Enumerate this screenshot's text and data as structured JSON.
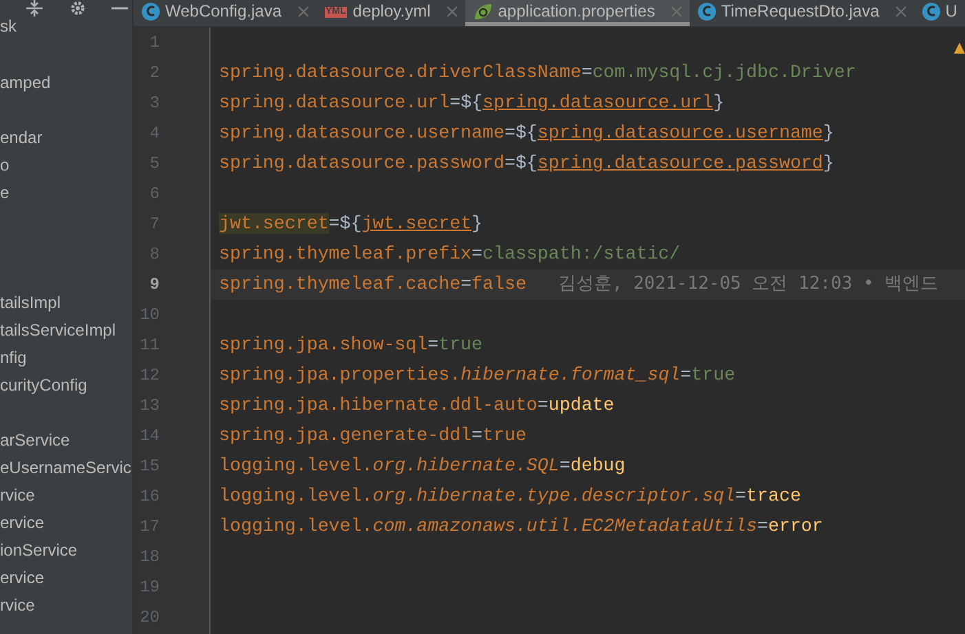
{
  "sidebar": {
    "items": [
      {
        "kind": "item",
        "label": "sk"
      },
      {
        "kind": "blank"
      },
      {
        "kind": "item",
        "label": "amped"
      },
      {
        "kind": "blank"
      },
      {
        "kind": "item",
        "label": "endar"
      },
      {
        "kind": "item",
        "label": "o"
      },
      {
        "kind": "item",
        "label": "e"
      },
      {
        "kind": "blank"
      },
      {
        "kind": "blank"
      },
      {
        "kind": "blank"
      },
      {
        "kind": "item",
        "label": "tailsImpl"
      },
      {
        "kind": "item",
        "label": "tailsServiceImpl"
      },
      {
        "kind": "item",
        "label": "nfig"
      },
      {
        "kind": "item",
        "label": "curityConfig"
      },
      {
        "kind": "blank"
      },
      {
        "kind": "item",
        "label": "arService"
      },
      {
        "kind": "item",
        "label": "eUsernameServic"
      },
      {
        "kind": "item",
        "label": "rvice"
      },
      {
        "kind": "item",
        "label": "ervice"
      },
      {
        "kind": "item",
        "label": "ionService"
      },
      {
        "kind": "item",
        "label": "ervice"
      },
      {
        "kind": "item",
        "label": "rvice"
      }
    ]
  },
  "tabs": [
    {
      "label": "WebConfig.java",
      "kind": "java",
      "selected": false
    },
    {
      "label": "deploy.yml",
      "kind": "yml",
      "icon_text": "YML",
      "selected": false
    },
    {
      "label": "application.properties",
      "kind": "spring",
      "selected": true
    },
    {
      "label": "TimeRequestDto.java",
      "kind": "java",
      "selected": false
    },
    {
      "label": "U",
      "kind": "java",
      "selected": false
    }
  ],
  "editor": {
    "lines": [
      {
        "number": "1",
        "current": false
      },
      {
        "number": "2",
        "current": false,
        "tokens": [
          {
            "t": "spring.datasource.driverClassName",
            "kind": "key"
          },
          {
            "t": "=",
            "kind": "eq"
          },
          {
            "t": "com.mysql.cj.jdbc.Driver",
            "kind": "value"
          }
        ]
      },
      {
        "number": "3",
        "current": false,
        "tokens": [
          {
            "t": "spring.datasource.url",
            "kind": "key"
          },
          {
            "t": "=",
            "kind": "eq"
          },
          {
            "t": "${",
            "kind": "brace"
          },
          {
            "t": "spring.datasource.url",
            "kind": "ref"
          },
          {
            "t": "}",
            "kind": "brace"
          }
        ]
      },
      {
        "number": "4",
        "current": false,
        "tokens": [
          {
            "t": "spring.datasource.username",
            "kind": "key"
          },
          {
            "t": "=",
            "kind": "eq"
          },
          {
            "t": "${",
            "kind": "brace"
          },
          {
            "t": "spring.datasource.username",
            "kind": "ref"
          },
          {
            "t": "}",
            "kind": "brace"
          }
        ]
      },
      {
        "number": "5",
        "current": false,
        "tokens": [
          {
            "t": "spring.datasource.password",
            "kind": "key"
          },
          {
            "t": "=",
            "kind": "eq"
          },
          {
            "t": "${",
            "kind": "brace"
          },
          {
            "t": "spring.datasource.password",
            "kind": "ref"
          },
          {
            "t": "}",
            "kind": "brace"
          }
        ]
      },
      {
        "number": "6",
        "current": false
      },
      {
        "number": "7",
        "current": false,
        "tokens": [
          {
            "t": "jwt.secret",
            "kind": "key_marked"
          },
          {
            "t": "=",
            "kind": "eq"
          },
          {
            "t": "${",
            "kind": "brace"
          },
          {
            "t": "jwt.secret",
            "kind": "ref"
          },
          {
            "t": "}",
            "kind": "brace"
          }
        ]
      },
      {
        "number": "8",
        "current": false,
        "tokens": [
          {
            "t": "spring.thymeleaf.prefix",
            "kind": "key"
          },
          {
            "t": "=",
            "kind": "eq"
          },
          {
            "t": "classpath:/static/",
            "kind": "value"
          }
        ]
      },
      {
        "number": "9",
        "current": true,
        "tokens": [
          {
            "t": "spring.thymeleaf.cache",
            "kind": "key"
          },
          {
            "t": "=",
            "kind": "eq"
          },
          {
            "t": "false",
            "kind": "key"
          }
        ],
        "annotation": "김성훈, 2021-12-05 오전 12:03 • 백엔드"
      },
      {
        "number": "10",
        "current": false
      },
      {
        "number": "11",
        "current": false,
        "tokens": [
          {
            "t": "spring.jpa.show-sql",
            "kind": "key"
          },
          {
            "t": "=",
            "kind": "eq"
          },
          {
            "t": "true",
            "kind": "value"
          }
        ]
      },
      {
        "number": "12",
        "current": false,
        "tokens": [
          {
            "t": "spring.jpa.properties.",
            "kind": "key"
          },
          {
            "t": "hibernate.format_sql",
            "kind": "key_italic"
          },
          {
            "t": "=",
            "kind": "eq"
          },
          {
            "t": "true",
            "kind": "value"
          }
        ]
      },
      {
        "number": "13",
        "current": false,
        "tokens": [
          {
            "t": "spring.jpa.hibernate.ddl-auto",
            "kind": "key"
          },
          {
            "t": "=",
            "kind": "eq"
          },
          {
            "t": "update",
            "kind": "keyword"
          }
        ]
      },
      {
        "number": "14",
        "current": false,
        "tokens": [
          {
            "t": "spring.jpa.generate-ddl",
            "kind": "key"
          },
          {
            "t": "=",
            "kind": "eq"
          },
          {
            "t": "true",
            "kind": "key"
          }
        ]
      },
      {
        "number": "15",
        "current": false,
        "tokens": [
          {
            "t": "logging.level.",
            "kind": "key"
          },
          {
            "t": "org.hibernate.SQL",
            "kind": "key_italic"
          },
          {
            "t": "=",
            "kind": "eq"
          },
          {
            "t": "debug",
            "kind": "keyword"
          }
        ]
      },
      {
        "number": "16",
        "current": false,
        "tokens": [
          {
            "t": "logging.level.",
            "kind": "key"
          },
          {
            "t": "org.hibernate.type.descriptor.sql",
            "kind": "key_italic"
          },
          {
            "t": "=",
            "kind": "eq"
          },
          {
            "t": "trace",
            "kind": "keyword"
          }
        ]
      },
      {
        "number": "17",
        "current": false,
        "tokens": [
          {
            "t": "logging.level.",
            "kind": "key"
          },
          {
            "t": "com.amazonaws.util.EC2MetadataUtils",
            "kind": "key_italic"
          },
          {
            "t": "=",
            "kind": "eq"
          },
          {
            "t": "error",
            "kind": "keyword"
          }
        ]
      },
      {
        "number": "18",
        "current": false
      },
      {
        "number": "19",
        "current": false
      },
      {
        "number": "20",
        "current": false
      }
    ]
  }
}
